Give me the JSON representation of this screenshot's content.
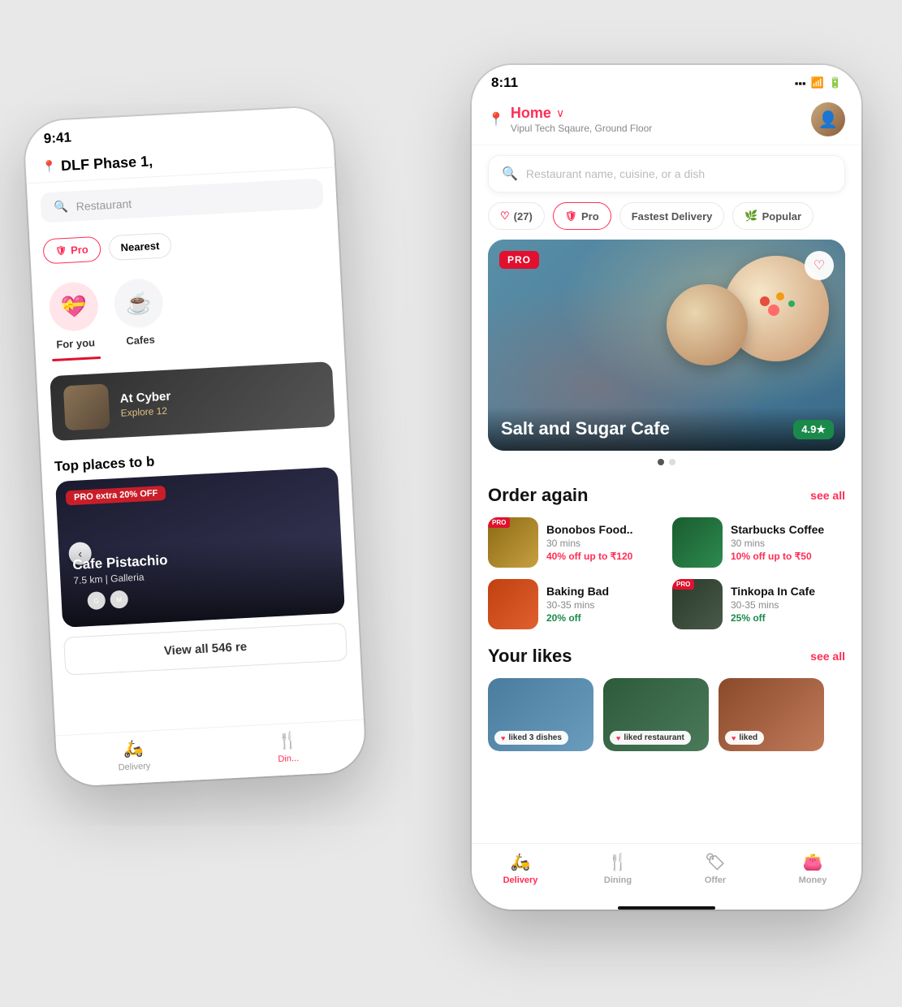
{
  "scene": {
    "background": "#e0e0e0"
  },
  "back_phone": {
    "status_bar": {
      "time": "9:41"
    },
    "location": "DLF Phase 1,",
    "search_placeholder": "Restaurant",
    "filters": [
      "Pro",
      "Nearest"
    ],
    "categories": [
      {
        "label": "For you",
        "icon": "💝",
        "active": true
      },
      {
        "label": "Cafes",
        "icon": "☕",
        "active": false
      }
    ],
    "promo_card": {
      "name": "At Cyber",
      "sub": "Explore 12"
    },
    "section_title": "Top places to b",
    "off_badge": "PRO extra 20% OFF",
    "featured_place": {
      "name": "Cafe Pistachio",
      "distance": "7.5 km | Galleria"
    },
    "view_all": "View all 546 re",
    "bottom_nav": [
      {
        "label": "Delivery",
        "active": false
      },
      {
        "label": "Din...",
        "active": true
      }
    ]
  },
  "front_phone": {
    "status_bar": {
      "time": "8:11",
      "signal": "▪▪▪",
      "wifi": "wifi",
      "battery": "battery"
    },
    "header": {
      "location_label": "Home",
      "location_sub": "Vipul Tech Sqaure, Ground Floor",
      "chevron": "∨"
    },
    "search_placeholder": "Restaurant name, cuisine, or a dish",
    "filters": [
      {
        "label": "(27)",
        "icon": "heart"
      },
      {
        "label": "Pro",
        "icon": "pro-shield"
      },
      {
        "label": "Fastest Delivery",
        "icon": ""
      },
      {
        "label": "Popular",
        "icon": "leaf"
      }
    ],
    "hero": {
      "pro_badge": "PRO",
      "name": "Salt and Sugar Cafe",
      "rating": "4.9★",
      "dots": 2
    },
    "order_again": {
      "title": "Order again",
      "see_all": "see all",
      "items": [
        {
          "name": "Bonobos Food..",
          "time": "30 mins",
          "discount": "40% off up to ₹120",
          "has_pro": true,
          "img_class": "img-bonobos"
        },
        {
          "name": "Starbucks Coffee",
          "time": "30 mins",
          "discount": "10% off up to ₹50",
          "has_pro": false,
          "img_class": "img-starbucks"
        },
        {
          "name": "Baking Bad",
          "time": "30-35 mins",
          "discount": "20% off",
          "has_pro": false,
          "img_class": "img-baking"
        },
        {
          "name": "Tinkopa In Cafe",
          "time": "30-35 mins",
          "discount": "25% off",
          "has_pro": true,
          "img_class": "img-tinkopa"
        }
      ]
    },
    "your_likes": {
      "title": "Your likes",
      "see_all": "see all",
      "items": [
        {
          "label": "liked 3 dishes",
          "bg_class": "like-bg-1"
        },
        {
          "label": "liked restaurant",
          "bg_class": "like-bg-2"
        },
        {
          "label": "liked",
          "bg_class": "like-bg-3"
        }
      ]
    },
    "bottom_nav": [
      {
        "label": "Delivery",
        "icon": "🛵",
        "active": true
      },
      {
        "label": "Dining",
        "icon": "🍴",
        "active": false
      },
      {
        "label": "Offer",
        "icon": "🏷",
        "active": false
      },
      {
        "label": "Money",
        "icon": "👛",
        "active": false
      }
    ]
  }
}
